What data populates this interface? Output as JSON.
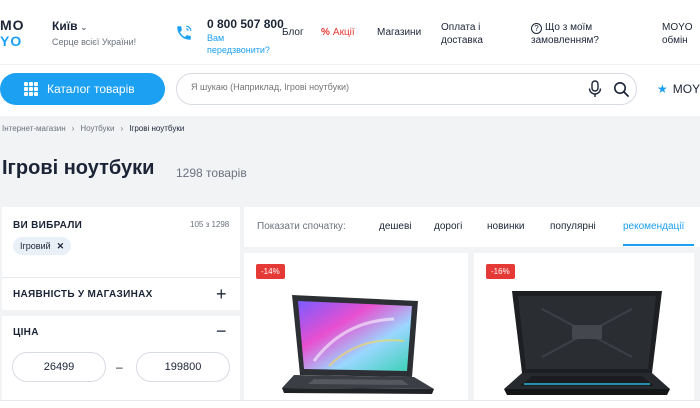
{
  "header": {
    "logo_top": "MO",
    "logo_bottom": "YO",
    "city": "Київ",
    "city_subtitle": "Серце всієї України!",
    "phone": "0 800 507 800",
    "callback": "Вам передзвонити?",
    "nav": {
      "blog": "Блог",
      "promo_symbol": "%",
      "promo": "Акції",
      "shops": "Магазини",
      "pay_line1": "Оплата і",
      "pay_line2": "доставка",
      "order_line1": "Що з моїм",
      "order_line2": "замовленням?",
      "exchange_line1": "MOYO",
      "exchange_line2": "обмін"
    }
  },
  "search": {
    "catalog_label": "Каталог товарів",
    "placeholder": "Я шукаю (Наприклад, Ігрові ноутбуки)",
    "favorites_label": "MOY"
  },
  "breadcrumb": {
    "items": [
      "Інтернет-магазин",
      "Ноутбуки",
      "Ігрові ноутбуки"
    ],
    "separator": "›"
  },
  "page": {
    "title": "Ігрові ноутбуки",
    "count": "1298 товарів"
  },
  "filters": {
    "selected_title": "ВИ ВИБРАЛИ",
    "selected_ratio": "105 з 1298",
    "chip_label": "Ігровий",
    "chip_close": "✕",
    "availability_title": "НАЯВНІСТЬ У МАГАЗИНАХ",
    "availability_toggle": "+",
    "price_title": "ЦІНА",
    "price_toggle": "−",
    "price_from": "26499",
    "price_to": "199800",
    "price_dash": "–"
  },
  "sort": {
    "label": "Показати спочатку:",
    "options": [
      "дешеві",
      "дорогі",
      "новинки",
      "популярні",
      "рекомендації"
    ],
    "active": "рекомендації"
  },
  "products": [
    {
      "badge": "-14%"
    },
    {
      "badge": "-16%"
    }
  ],
  "colors": {
    "accent": "#1ca0f2",
    "sale": "#e53935",
    "text": "#1b2436",
    "muted": "#6b7280",
    "background": "#f2f3f5"
  }
}
